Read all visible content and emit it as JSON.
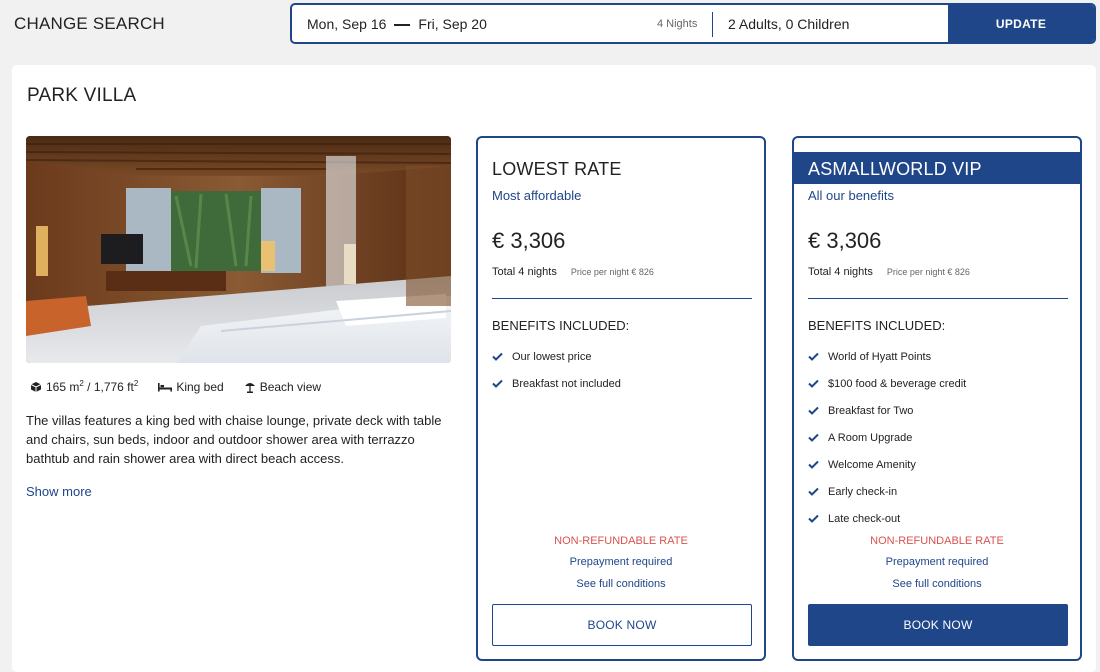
{
  "search": {
    "change_label": "CHANGE SEARCH",
    "check_in": "Mon, Sep 16",
    "check_out": "Fri, Sep 20",
    "nights": "4 Nights",
    "guests": "2 Adults, 0 Children",
    "update_label": "UPDATE"
  },
  "room": {
    "title": "PARK VILLA",
    "size_m2": "165 m",
    "size_ft2": " / 1,776 ft",
    "bed": "King bed",
    "view": "Beach view",
    "description": "The villas features a king bed with chaise lounge, private deck with table and chairs, sun beds, indoor and outdoor shower area with terrazzo bathtub and rain shower area with direct beach access.",
    "show_more": "Show more"
  },
  "rates": [
    {
      "title": "LOWEST RATE",
      "subtitle": "Most affordable",
      "price": "€ 3,306",
      "total": "Total 4 nights",
      "per_night": "Price per night € 826",
      "benefits_heading": "BENEFITS INCLUDED:",
      "benefits": [
        "Our lowest price",
        "Breakfast not included"
      ],
      "refund": "NON-REFUNDABLE RATE",
      "prepay": "Prepayment required",
      "conditions": "See full conditions",
      "book": "BOOK NOW"
    },
    {
      "title": "ASMALLWORLD VIP",
      "subtitle": "All our benefits",
      "price": "€ 3,306",
      "total": "Total 4 nights",
      "per_night": "Price per night € 826",
      "benefits_heading": "BENEFITS INCLUDED:",
      "benefits": [
        "World of Hyatt Points",
        "$100 food & beverage credit",
        "Breakfast for Two",
        "A Room Upgrade",
        "Welcome Amenity",
        "Early check-in",
        "Late check-out"
      ],
      "refund": "NON-REFUNDABLE RATE",
      "prepay": "Prepayment required",
      "conditions": "See full conditions",
      "book": "BOOK NOW"
    }
  ],
  "colors": {
    "brand": "#20468a",
    "alert": "#d9534f"
  },
  "icons": {
    "size": "cube-icon",
    "bed": "bed-icon",
    "view": "beach-umbrella-icon",
    "check": "check-icon"
  }
}
